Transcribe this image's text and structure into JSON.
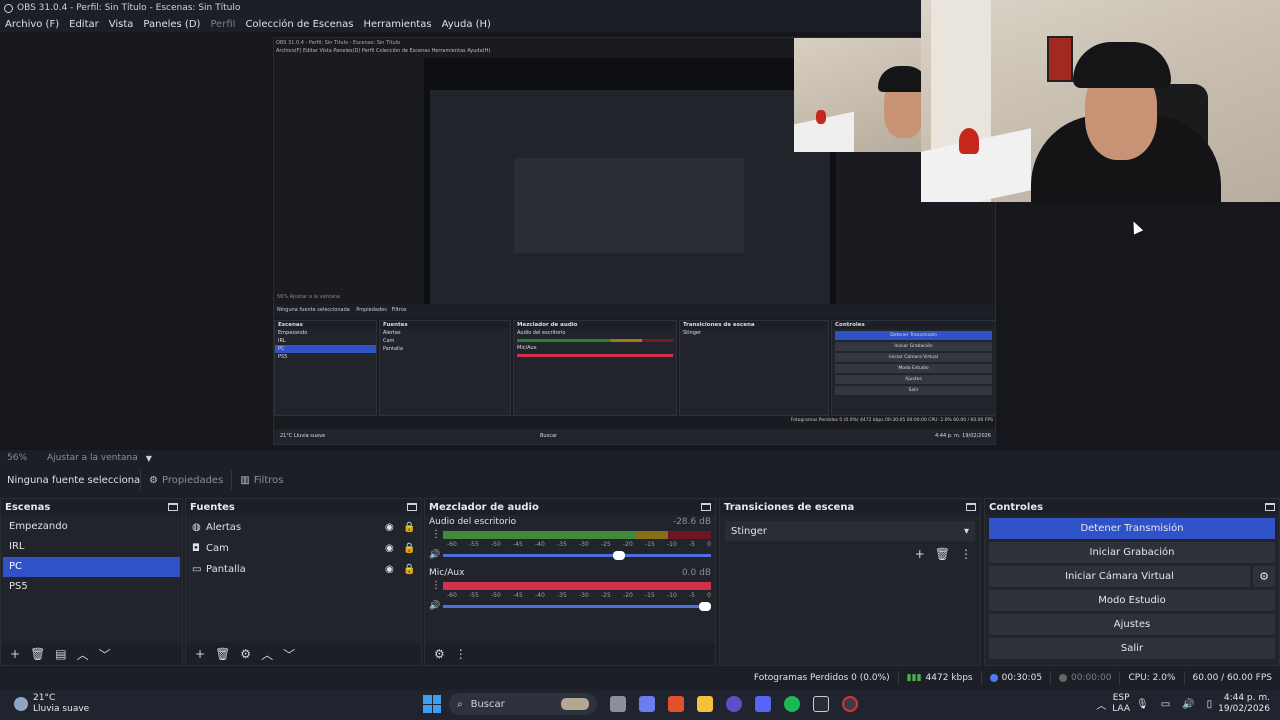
{
  "window": {
    "title": "OBS 31.0.4 - Perfil: Sin Título - Escenas: Sin Título"
  },
  "menu": [
    "Archivo (F)",
    "Editar",
    "Vista",
    "Paneles (D)",
    "Perfil",
    "Colección de Escenas",
    "Herramientas",
    "Ayuda (H)"
  ],
  "menu_disabled_index": 4,
  "nested_preview": {
    "title": "OBS 31.0.4 - Perfil: Sin Título - Escenas: Sin Título",
    "menu": "Archivo(F)  Editar  Vista  Paneles(D)  Perfil  Colección de Escenas  Herramientas  Ayuda(H)",
    "scale": "56%   Ajustar a la ventana",
    "source_label": "Ninguna fuente seleccionada",
    "toolbar_props": "Propiedades",
    "toolbar_filters": "Filtros",
    "scenes_title": "Escenas",
    "scenes": [
      "Empezando",
      "IRL",
      "PC",
      "PS5"
    ],
    "sources_title": "Fuentes",
    "sources": [
      "Alertas",
      "Cam",
      "Pantalla"
    ],
    "mixer_title": "Mezclador de audio",
    "mixer_desktop": "Audio del escritorio",
    "mixer_mic": "Mic/Aux",
    "trans_title": "Transiciones de escena",
    "trans_value": "Stinger",
    "controls_title": "Controles",
    "controls": [
      "Detener Transmisión",
      "Iniciar Grabación",
      "Iniciar Cámara Virtual",
      "Modo Estudio",
      "Ajustes",
      "Salir"
    ],
    "status": "Fotogramas Perdidos 0 (0.0%)   4472 kbps   00:30:05   00:00:00   CPU: 2.0%   60.00 / 60.00 FPS",
    "weather": "21°C  Lluvia suave",
    "search": "Buscar",
    "clock": "4:44 p. m.  19/02/2026"
  },
  "scalebar": {
    "zoom": "56%",
    "fit": "Ajustar a la ventana"
  },
  "toolbar": {
    "source": "Ninguna fuente seleccionada",
    "properties": "Propiedades",
    "filters": "Filtros"
  },
  "scenes": {
    "title": "Escenas",
    "items": [
      "Empezando",
      "IRL",
      "PC",
      "PS5"
    ],
    "selected_index": 2
  },
  "sources": {
    "title": "Fuentes",
    "items": [
      {
        "name": "Alertas",
        "icon": "globe-icon"
      },
      {
        "name": "Cam",
        "icon": "camera-icon"
      },
      {
        "name": "Pantalla",
        "icon": "monitor-icon"
      }
    ]
  },
  "mixer": {
    "title": "Mezclador de audio",
    "channels": [
      {
        "name": "Audio del escritorio",
        "db": "-28.6 dB",
        "meter": "green",
        "volume_fraction": 0.68
      },
      {
        "name": "Mic/Aux",
        "db": "0.0 dB",
        "meter": "red",
        "volume_fraction": 1.0
      }
    ],
    "ticks": [
      "-60",
      "-55",
      "-50",
      "-45",
      "-40",
      "-35",
      "-30",
      "-25",
      "-20",
      "-15",
      "-10",
      "-5",
      "0"
    ]
  },
  "transitions": {
    "title": "Transiciones de escena",
    "value": "Stinger"
  },
  "controls": {
    "title": "Controles",
    "stop_stream": "Detener Transmisión",
    "start_record": "Iniciar Grabación",
    "virtual_cam": "Iniciar Cámara Virtual",
    "studio_mode": "Modo Estudio",
    "settings": "Ajustes",
    "exit": "Salir"
  },
  "status": {
    "dropped": "Fotogramas Perdidos 0 (0.0%)",
    "bitrate": "4472 kbps",
    "stream_time": "00:30:05",
    "record_time": "00:00:00",
    "cpu": "CPU: 2.0%",
    "fps": "60.00 / 60.00 FPS"
  },
  "taskbar": {
    "temp": "21°C",
    "weather": "Lluvia suave",
    "search": "Buscar",
    "lang1": "ESP",
    "lang2": "LAA",
    "time": "4:44 p. m.",
    "date": "19/02/2026"
  },
  "colors": {
    "accent": "#2f52c9",
    "panel": "#22242b",
    "header": "#1d1f26",
    "meter_red": "#d2304f"
  }
}
